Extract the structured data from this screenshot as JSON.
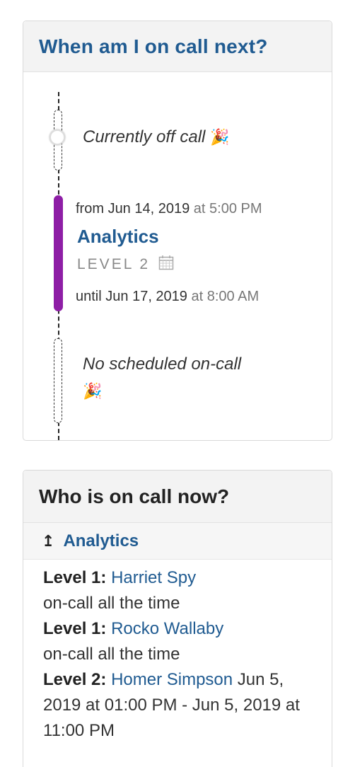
{
  "next_oncall": {
    "title": "When am I on call next?",
    "current_status": "Currently off call",
    "shift": {
      "from_label": "from",
      "from_date": "Jun 14, 2019",
      "from_time": "at 5:00 PM",
      "schedule_name": "Analytics",
      "level": "LEVEL 2",
      "until_label": "until",
      "until_date": "Jun 17, 2019",
      "until_time": "at 8:00 AM"
    },
    "future_status": "No scheduled on-call",
    "party_emoji": "🎉"
  },
  "oncall_now": {
    "title": "Who is on call now?",
    "group_arrow": "↥",
    "group_name": "Analytics",
    "entries": [
      {
        "level": "Level 1:",
        "person": "Harriet Spy",
        "detail": "on-call all the time"
      },
      {
        "level": "Level 1:",
        "person": "Rocko Wallaby",
        "detail": "on-call all the time"
      },
      {
        "level": "Level 2:",
        "person": "Homer Simpson",
        "detail": "Jun 5, 2019 at 01:00 PM - Jun 5, 2019 at 11:00 PM"
      }
    ]
  },
  "colors": {
    "link": "#205b91",
    "oncall_bar": "#8e1ea6"
  }
}
